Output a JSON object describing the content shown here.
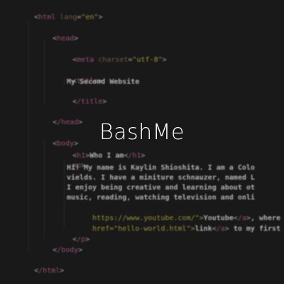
{
  "brand": {
    "name": "BashMe"
  },
  "code": {
    "html_open_tag": "html",
    "lang_attr": "lang",
    "lang_value": "\"en\"",
    "head_open": "head",
    "meta_tag": "meta",
    "charset_attr": "charset",
    "charset_value": "\"utf-8\"",
    "title_open": "title",
    "title_text": "My Second Website",
    "title_close": "/title",
    "head_close": "/head",
    "body_open": "body",
    "h1_open": "h1",
    "h1_text": "Who I am",
    "h1_close": "/h1",
    "p_open": "p",
    "para_line_1": "Hi! My name is Kaylin Shioshita. I am a Colo",
    "para_line_2": "vields. I have a miniture schnauzer, named L",
    "para_line_3": "I enjoy being creative and learning about ot",
    "para_line_4": "music, reading, watching television and onli",
    "para_line_5_prefix": "https://www.youtube.com/\">",
    "para_line_5_link": "Youtube",
    "para_line_5_close": "/a",
    "para_line_5_suffix": ", where",
    "para_line_6_prefix": "href=\"hello-world.html\">",
    "para_line_6_link": "link",
    "para_line_6_close": "/a",
    "para_line_6_suffix": " to my first",
    "p_close": "/p",
    "body_close": "/body",
    "html_close": "/html"
  },
  "colors": {
    "background": "#202020",
    "tag": "#d06aa7",
    "attribute": "#9b7b55",
    "string": "#d3c44a",
    "text": "#f0f0f0",
    "brand_text": "#ffffff"
  }
}
